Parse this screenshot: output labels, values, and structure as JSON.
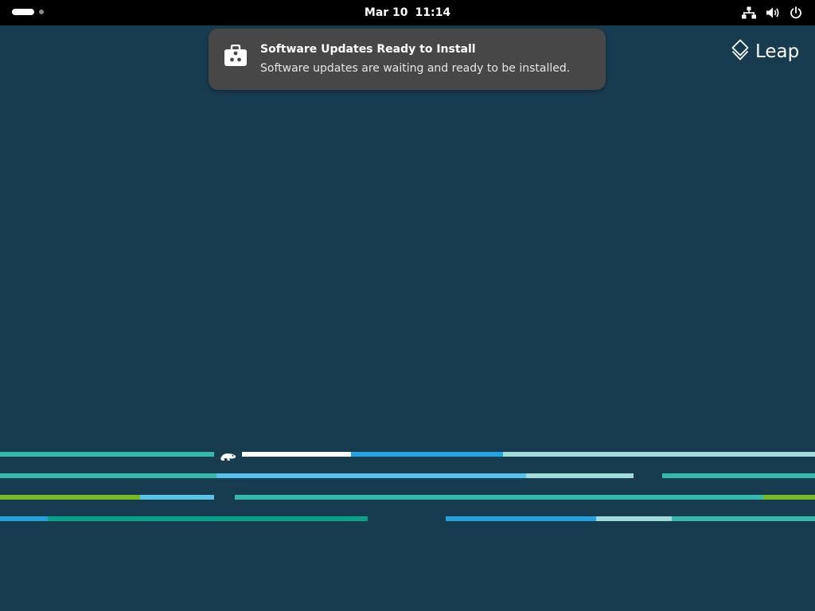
{
  "topbar": {
    "date": "Mar 10",
    "time": "11:14",
    "icons": [
      "activities-indicator",
      "network-icon",
      "volume-icon",
      "power-icon"
    ]
  },
  "notification": {
    "icon": "software-updates-icon",
    "title": "Software Updates Ready to Install",
    "body": "Software updates are waiting and ready to be installed."
  },
  "branding": {
    "logo_icon": "leap-logo-icon",
    "text": "Leap"
  },
  "colors": {
    "background": "#173c4f",
    "topbar": "#000000",
    "notification_bg": "#474747",
    "stripe_teal": "#35b9ab",
    "stripe_blue": "#21a4df",
    "stripe_lightblue": "#5ac1ea",
    "stripe_mint": "#a1ddd8",
    "stripe_green": "#73ba25",
    "stripe_darkteal": "#00a489",
    "stripe_white": "#ffffff"
  }
}
